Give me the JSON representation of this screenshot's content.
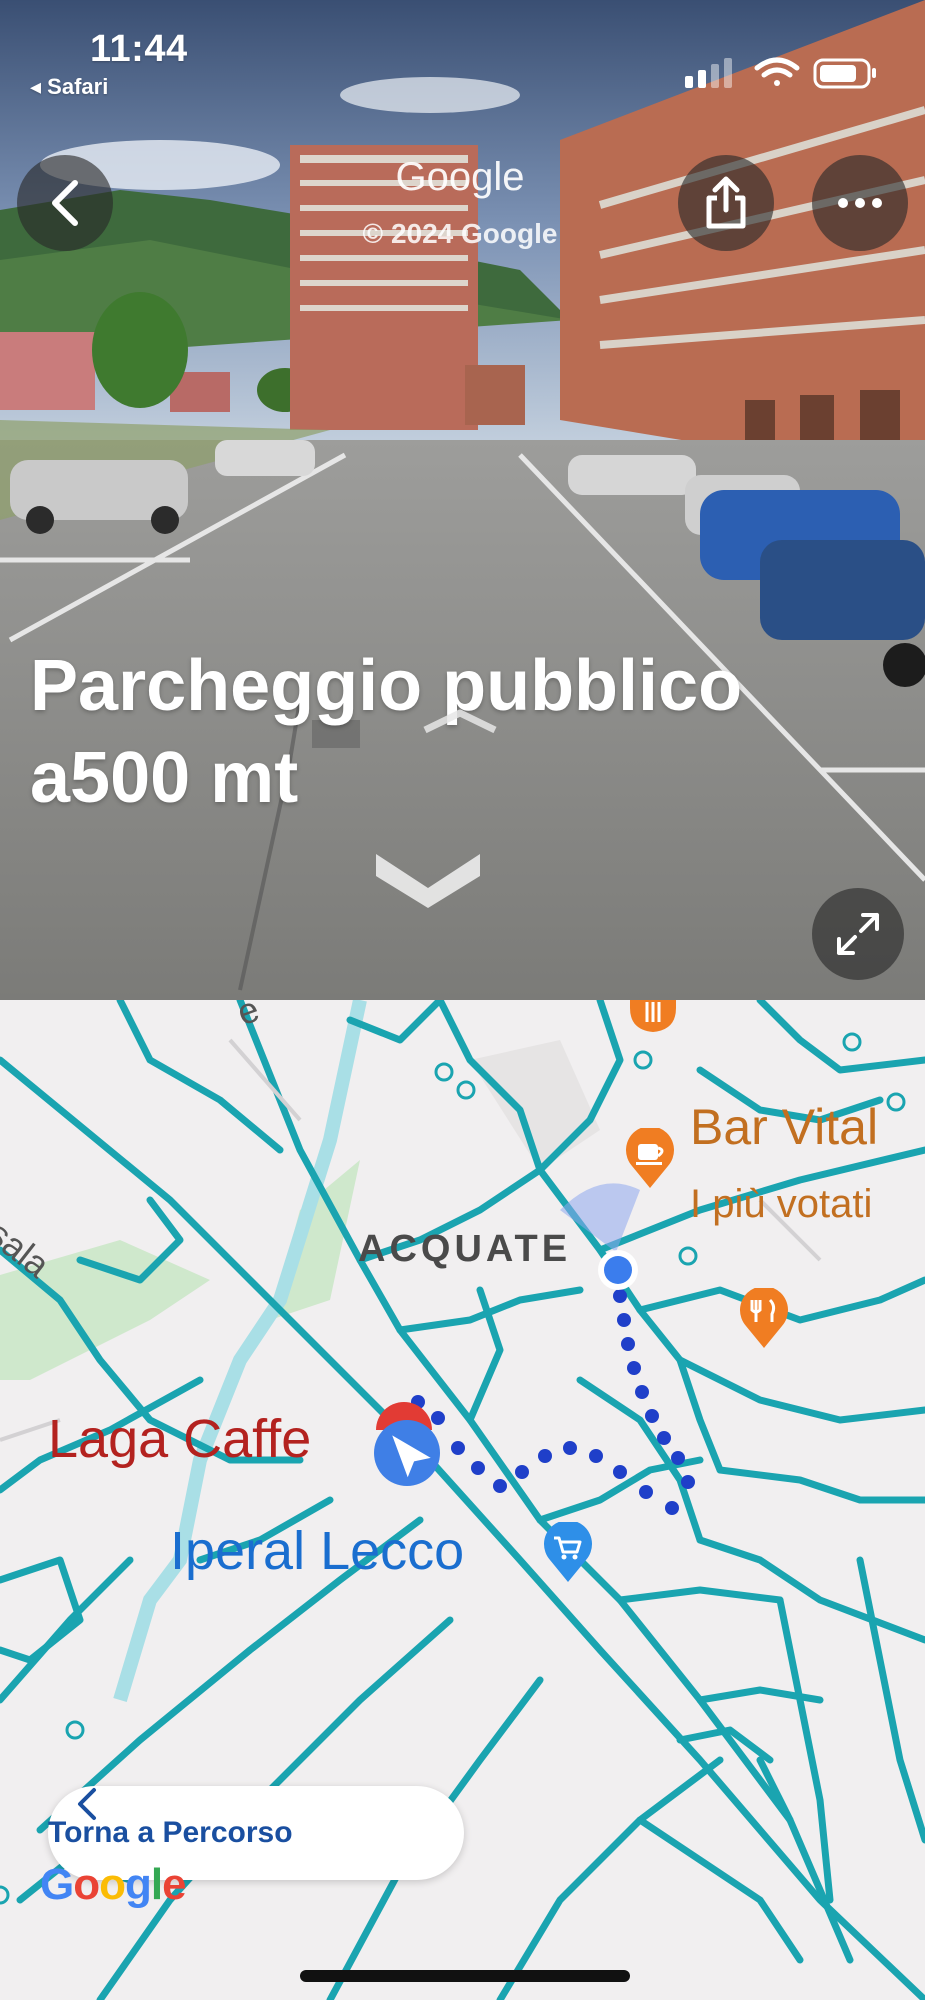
{
  "status_bar": {
    "time": "11:44",
    "back_app": "◂ Safari"
  },
  "street_view": {
    "watermark": "Google",
    "copyright": "© 2024 Google",
    "caption_line1": "Parcheggio pubblico",
    "caption_line2": "a500 mt",
    "icons": [
      "back-arrow-icon",
      "share-icon",
      "more-icon",
      "expand-icon",
      "navigation-chevron-icon"
    ]
  },
  "map": {
    "labels": {
      "bar_name": "Bar Vital",
      "bar_note": "I più votati",
      "neighborhood": "ACQUATE",
      "cafe": "Laga Caffe",
      "store": "Iperal Lecco",
      "street_partial": "rsala",
      "street_partial_top": "e"
    },
    "icons": [
      "restaurant-icon",
      "coffee-icon",
      "shopping-cart-icon",
      "location-dot-icon",
      "compass-arrow-icon",
      "pin-icon"
    ],
    "route_button": "Torna a Percorso",
    "logo": "Google"
  },
  "colors": {
    "road": "#1aa4b0",
    "route_dots": "#1f3fc9",
    "bar_label": "#c26f20",
    "cafe_label": "#b3221f",
    "store_label": "#1a6ecf",
    "poi_orange": "#f07d22",
    "location_blue": "#3b7ded"
  }
}
